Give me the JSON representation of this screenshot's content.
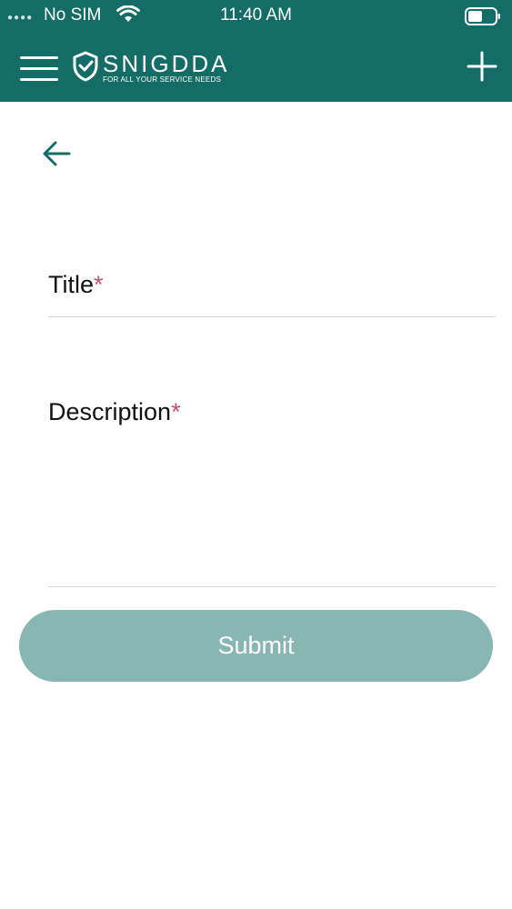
{
  "status_bar": {
    "carrier": "No SIM",
    "time": "11:40 AM"
  },
  "header": {
    "brand": "SNIGDDA",
    "tagline": "FOR ALL YOUR SERVICE NEEDS",
    "menu_icon": "hamburger-icon",
    "add_icon": "plus-icon",
    "background_color": "#136d66"
  },
  "form": {
    "back_icon": "arrow-left-icon",
    "title_label": "Title",
    "title_required_mark": "*",
    "title_value": "",
    "description_label": "Description",
    "description_required_mark": "*",
    "description_value": "",
    "submit_label": "Submit",
    "submit_color": "#88b7b3",
    "required_color": "#c2506b"
  }
}
